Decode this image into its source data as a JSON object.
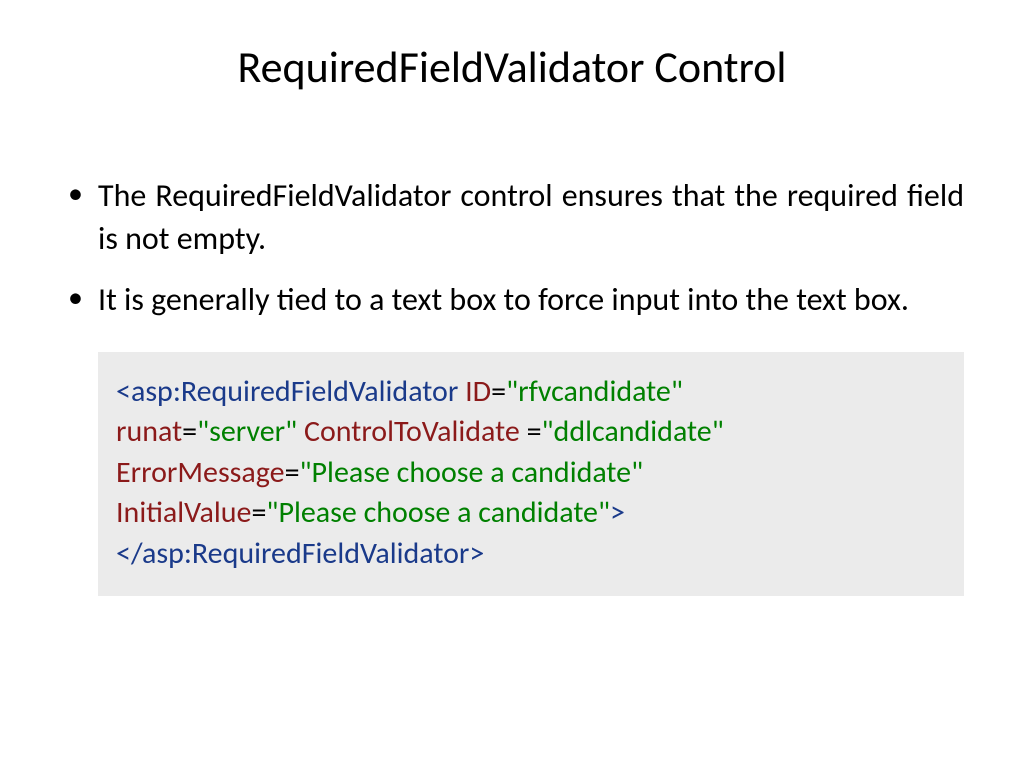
{
  "title": "RequiredFieldValidator Control",
  "bullets": [
    "The RequiredFieldValidator control ensures that the required field is not empty.",
    "It is generally tied to a text box to force input into the text box."
  ],
  "code": {
    "open_bracket": "<",
    "tag_open": "asp:RequiredFieldValidator",
    "attr_id": "ID",
    "val_id": "\"rfvcandidate\"",
    "attr_runat": "runat",
    "val_runat": "\"server\"",
    "attr_ctv": "ControlToValidate",
    "val_ctv": "\"ddlcandidate\"",
    "attr_err": "ErrorMessage",
    "val_err": "\"Please choose a candidate\"",
    "attr_init": "InitialValue",
    "val_init": "\"Please choose a candidate\"",
    "close_bracket": ">",
    "close_tag_open": "</",
    "tag_close": "asp:RequiredFieldValidator",
    "close_bracket2": ">",
    "eq": "="
  }
}
